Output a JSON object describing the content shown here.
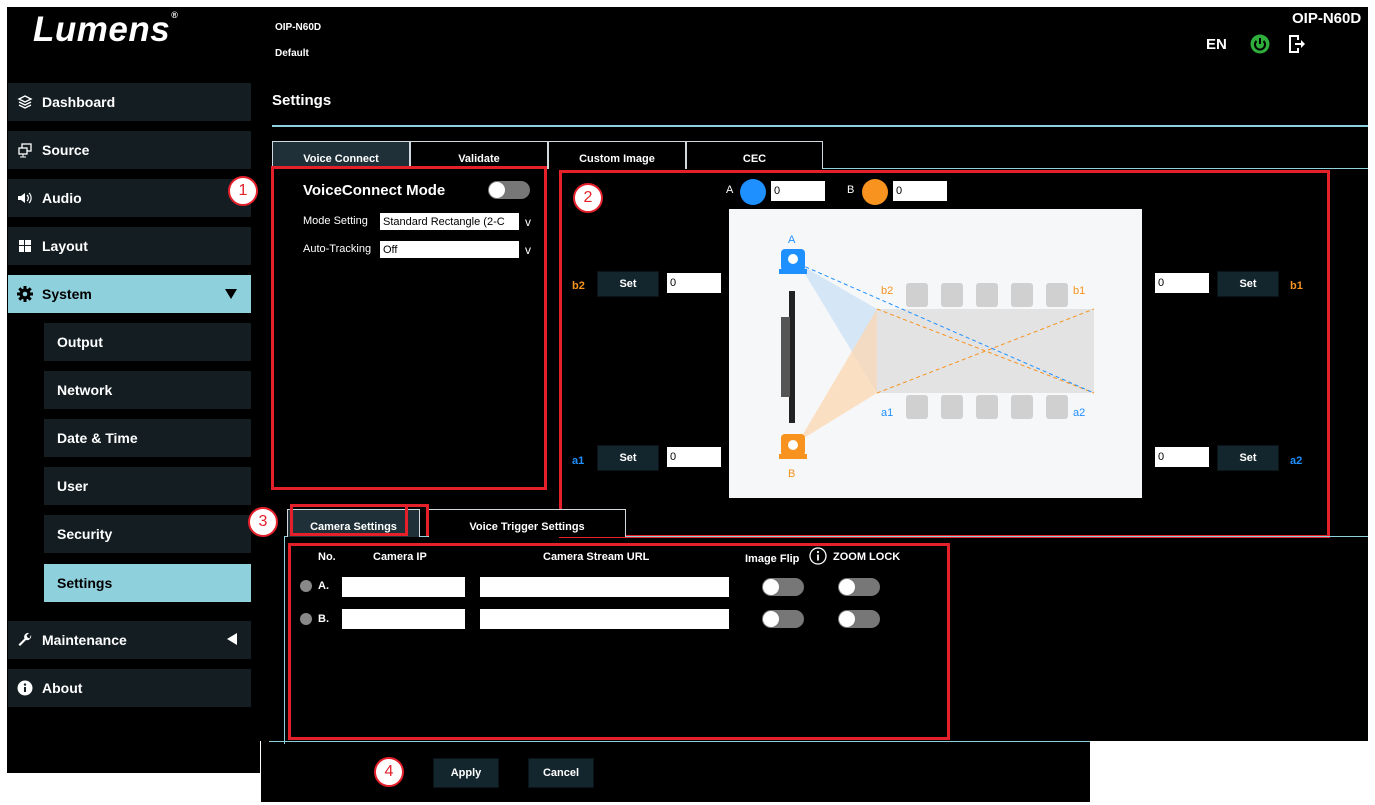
{
  "header": {
    "brand": "Lumens",
    "model": "OIP-N60D",
    "profile": "Default",
    "model_right": "OIP-N60D",
    "language": "EN"
  },
  "sidebar": {
    "items": [
      {
        "label": "Dashboard",
        "icon": "layers-icon"
      },
      {
        "label": "Source",
        "icon": "source-icon"
      },
      {
        "label": "Audio",
        "icon": "speaker-icon"
      },
      {
        "label": "Layout",
        "icon": "layout-icon"
      },
      {
        "label": "System",
        "icon": "gear-icon"
      },
      {
        "label": "Maintenance",
        "icon": "wrench-icon"
      },
      {
        "label": "About",
        "icon": "info-icon"
      }
    ],
    "system_sub": [
      "Output",
      "Network",
      "Date & Time",
      "User",
      "Security",
      "Settings"
    ]
  },
  "page": {
    "title": "Settings"
  },
  "tabs": [
    "Voice Connect",
    "Validate",
    "Custom Image",
    "CEC"
  ],
  "voice": {
    "mode_title": "VoiceConnect Mode",
    "mode_setting_label": "Mode Setting",
    "mode_setting_value": "Standard Rectangle (2-C",
    "auto_tracking_label": "Auto-Tracking",
    "auto_tracking_value": "Off"
  },
  "calib": {
    "cam_a_label": "A",
    "cam_a_value": "0",
    "cam_b_label": "B",
    "cam_b_value": "0",
    "set_label": "Set",
    "b2": {
      "label": "b2",
      "value": "0"
    },
    "b1": {
      "label": "b1",
      "value": "0"
    },
    "a1": {
      "label": "a1",
      "value": "0"
    },
    "a2": {
      "label": "a2",
      "value": "0"
    },
    "diagram": {
      "a": "A",
      "b": "B",
      "b2": "b2",
      "b1": "b1",
      "a1": "a1",
      "a2": "a2"
    }
  },
  "subtabs": [
    "Camera Settings",
    "Voice Trigger Settings"
  ],
  "camera": {
    "headers": {
      "no": "No.",
      "ip": "Camera IP",
      "url": "Camera Stream URL",
      "flip": "Image Flip",
      "zoom": "ZOOM LOCK"
    },
    "rows": [
      {
        "no": "A."
      },
      {
        "no": "B."
      }
    ]
  },
  "actions": {
    "apply": "Apply",
    "cancel": "Cancel"
  },
  "markers": [
    "1",
    "2",
    "3",
    "4"
  ],
  "colors": {
    "accent": "#8fd0dd",
    "annotation": "#e4202b",
    "camera_a": "#1e90ff",
    "camera_b": "#f7931e"
  }
}
